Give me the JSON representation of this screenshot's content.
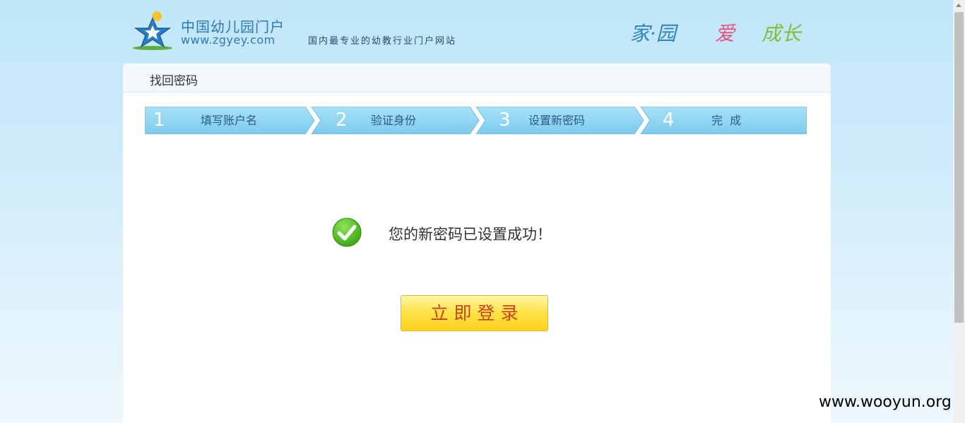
{
  "header": {
    "logo_title": "中国幼儿园门户",
    "logo_url": "www.zgyey.com",
    "slogan": "国内最专业的幼教行业门户网站",
    "motto": {
      "part1": "家·园",
      "part2": "爱",
      "part3": "成长"
    }
  },
  "panel": {
    "title": "找回密码",
    "steps": [
      {
        "num": "1",
        "label": "填写账户名"
      },
      {
        "num": "2",
        "label": "验证身份"
      },
      {
        "num": "3",
        "label": "设置新密码"
      },
      {
        "num": "4",
        "label": "完  成"
      }
    ],
    "success_message": "您的新密码已设置成功！",
    "login_button": "立即登录"
  },
  "watermark": "www.wooyun.org",
  "colors": {
    "brand_blue": "#2f78b8",
    "step_blue": "#8fd3f2",
    "button_yellow": "#ffe44a",
    "button_text": "#c8431a",
    "check_green": "#4cb81f"
  }
}
